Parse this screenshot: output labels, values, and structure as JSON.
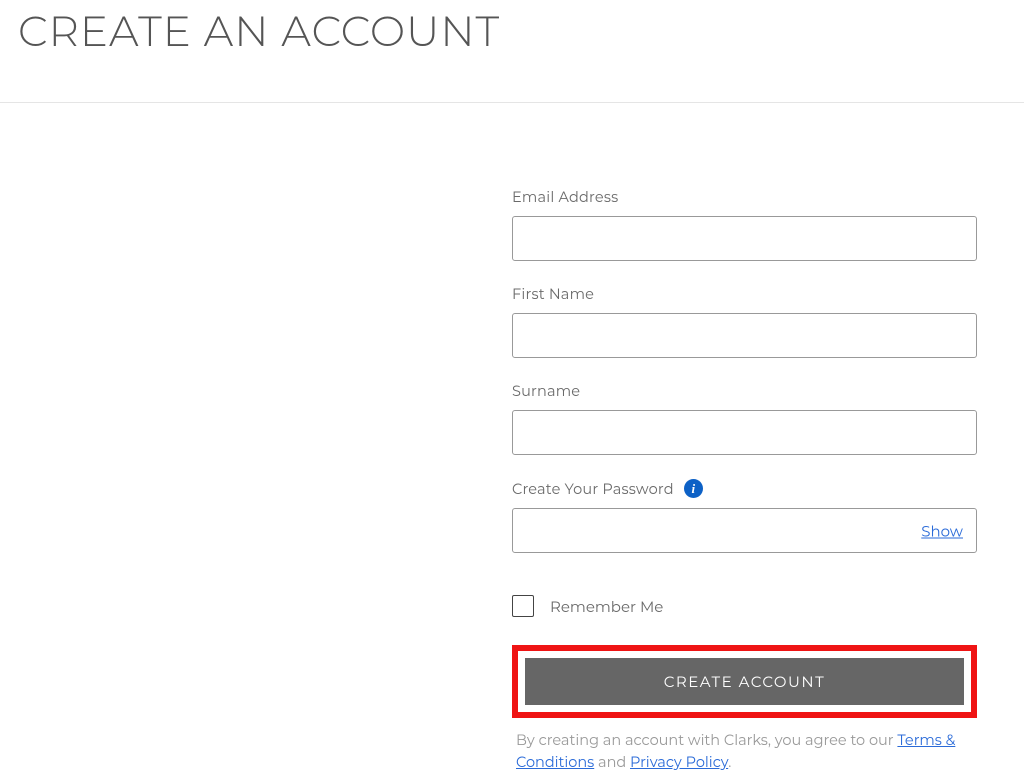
{
  "page": {
    "title": "CREATE AN ACCOUNT"
  },
  "form": {
    "email": {
      "label": "Email Address",
      "value": ""
    },
    "firstName": {
      "label": "First Name",
      "value": ""
    },
    "surname": {
      "label": "Surname",
      "value": ""
    },
    "password": {
      "label": "Create Your Password",
      "value": "",
      "showToggle": "Show"
    },
    "remember": {
      "label": "Remember Me",
      "checked": false
    },
    "submit": {
      "label": "CREATE ACCOUNT"
    },
    "legal": {
      "prefix": "By creating an account with Clarks, you agree to our ",
      "termsLabel": "Terms & Conditions",
      "middle": " and ",
      "privacyLabel": "Privacy Policy",
      "suffix": "."
    }
  }
}
